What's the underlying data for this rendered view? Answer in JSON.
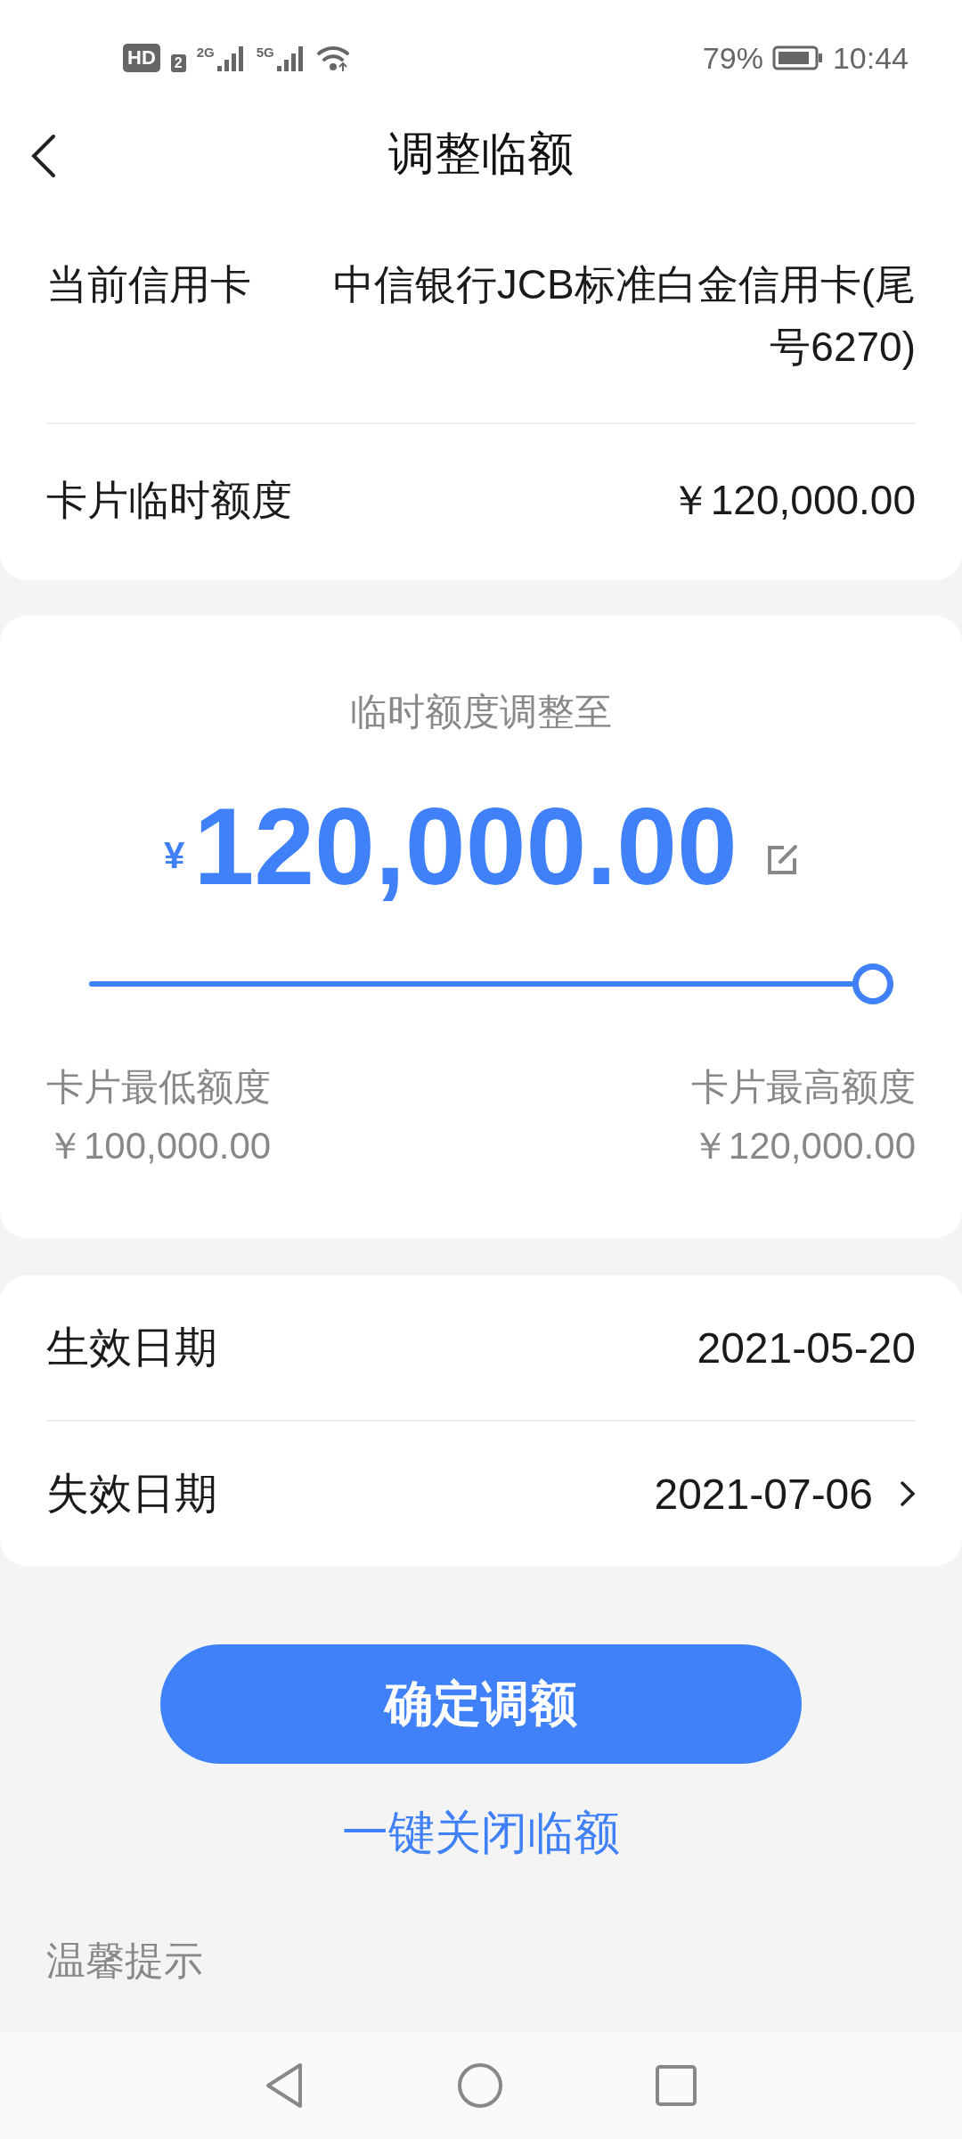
{
  "status_bar": {
    "hd_badge": "HD",
    "sim_badge": "2",
    "network_1": "2G",
    "network_2": "5G",
    "battery": "79%",
    "time": "10:44"
  },
  "header": {
    "title": "调整临额"
  },
  "card_info": {
    "rows": [
      {
        "label": "当前信用卡",
        "value": "中信银行JCB标准白金信用卡(尾号6270)"
      },
      {
        "label": "卡片临时额度",
        "value": "￥120,000.00"
      }
    ]
  },
  "adjust": {
    "label": "临时额度调整至",
    "currency": "¥",
    "amount": "120,000.00",
    "slider": {
      "level": 1.0
    },
    "min_label": "卡片最低额度",
    "min_value": "￥100,000.00",
    "max_label": "卡片最高额度",
    "max_value": "￥120,000.00"
  },
  "dates": {
    "rows": [
      {
        "label": "生效日期",
        "value": "2021-05-20",
        "kind": "static"
      },
      {
        "label": "失效日期",
        "value": "2021-07-06",
        "kind": "link"
      }
    ]
  },
  "confirm_button": "确定调额",
  "close_link": "一键关闭临额",
  "tips_title": "温馨提示"
}
